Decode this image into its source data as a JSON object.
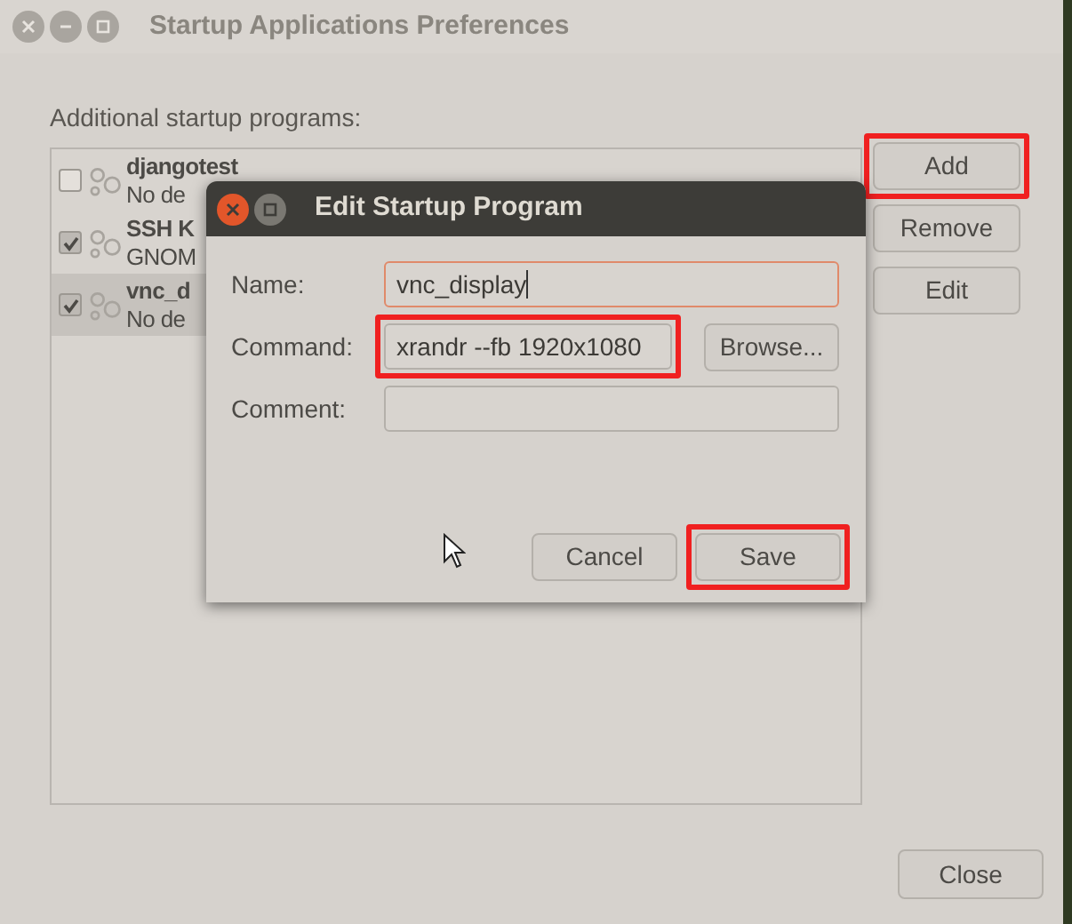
{
  "window": {
    "title": "Startup Applications Preferences"
  },
  "list": {
    "label": "Additional startup programs:",
    "items": [
      {
        "name": "djangotest",
        "description": "No de",
        "checked": false,
        "selected": false
      },
      {
        "name": "SSH K",
        "description": "GNOM",
        "checked": true,
        "selected": false
      },
      {
        "name": "vnc_d",
        "description": "No de",
        "checked": true,
        "selected": true
      }
    ]
  },
  "side_buttons": [
    {
      "label": "Add",
      "highlighted": true
    },
    {
      "label": "Remove",
      "highlighted": false
    },
    {
      "label": "Edit",
      "highlighted": false
    }
  ],
  "close_button": {
    "label": "Close"
  },
  "dialog": {
    "title": "Edit Startup Program",
    "fields": [
      {
        "label": "Name:",
        "value": "vnc_display",
        "focused": true,
        "highlighted": false
      },
      {
        "label": "Command:",
        "value": "xrandr --fb 1920x1080",
        "focused": false,
        "highlighted": true,
        "button": "Browse..."
      },
      {
        "label": "Comment:",
        "focused": false,
        "highlighted": false
      }
    ],
    "buttons": [
      {
        "label": "Cancel",
        "highlighted": false
      },
      {
        "label": "Save",
        "highlighted": true
      }
    ]
  }
}
